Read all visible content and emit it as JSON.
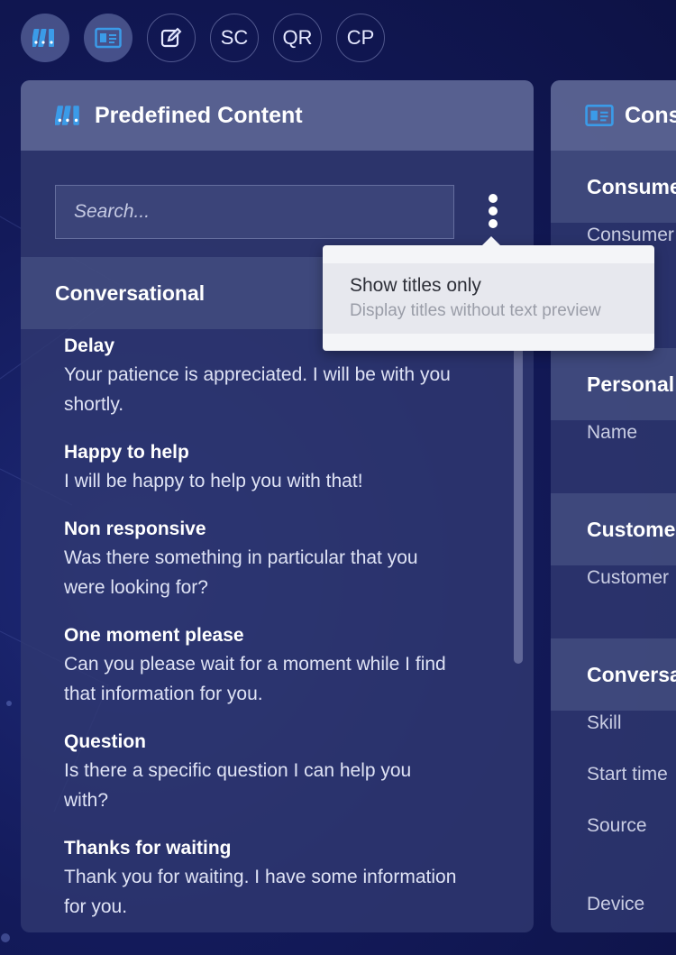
{
  "toolbar": {
    "buttons": [
      {
        "icon": "binders-icon",
        "label": ""
      },
      {
        "icon": "id-card-icon",
        "label": ""
      },
      {
        "icon": "edit-icon",
        "label": ""
      },
      {
        "label": "SC"
      },
      {
        "label": "QR"
      },
      {
        "label": "CP"
      }
    ]
  },
  "left_panel": {
    "title": "Predefined Content",
    "icon": "binders-icon",
    "search": {
      "placeholder": "Search...",
      "value": ""
    },
    "section": "Conversational",
    "items": [
      {
        "title": "Delay",
        "text": "Your patience is appreciated. I will be with you shortly."
      },
      {
        "title": "Happy to help",
        "text": "I will be happy to help you with that!"
      },
      {
        "title": "Non responsive",
        "text": "Was there something in particular that you were looking for?"
      },
      {
        "title": "One moment please",
        "text": "Can you please wait for a moment while I find that information for you."
      },
      {
        "title": "Question",
        "text": "Is there a specific question I can help you with?"
      },
      {
        "title": "Thanks for waiting",
        "text": "Thank you for waiting. I have some information for you."
      }
    ]
  },
  "menu": {
    "item_title": "Show titles only",
    "item_description": "Display titles without text preview"
  },
  "right_panel": {
    "title": "Cons",
    "icon": "id-card-icon",
    "sections": [
      "Consume",
      "Personal",
      "Custome",
      "Conversa"
    ],
    "fields": [
      "Consumer",
      "mer",
      "Name",
      "Customer",
      "Skill",
      "Start time",
      "Source",
      "Device"
    ]
  },
  "colors": {
    "accent": "#3b9be8",
    "background": "#131a5a"
  }
}
